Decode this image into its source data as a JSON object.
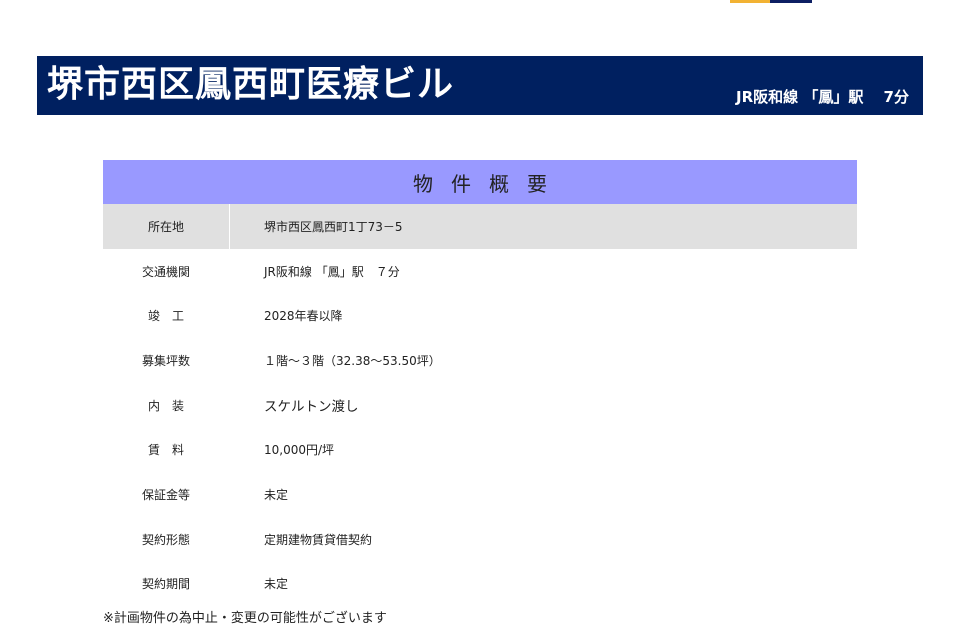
{
  "header": {
    "title": "堺市西区鳳西町医療ビル",
    "access": "JR阪和線 「鳳」駅　 7分"
  },
  "summary": {
    "heading": "物件概要",
    "rows": [
      {
        "label": "所在地",
        "value": "堺市西区鳳西町1丁73－5"
      },
      {
        "label": "交通機関",
        "value": "JR阪和線 「鳳」駅　７分"
      },
      {
        "label": "竣　工",
        "value": "2028年春以降"
      },
      {
        "label": "募集坪数",
        "value": "１階～３階（32.38～53.50坪）"
      },
      {
        "label": "内　装",
        "value": "スケルトン渡し"
      },
      {
        "label": "賃　料",
        "value": "10,000円/坪"
      },
      {
        "label": "保証金等",
        "value": "未定"
      },
      {
        "label": "契約形態",
        "value": "定期建物賃貸借契約"
      },
      {
        "label": "契約期間",
        "value": "未定"
      }
    ]
  },
  "note": "※計画物件の為中止・変更の可能性がございます",
  "colors": {
    "header_bg": "#002060",
    "summary_head_bg": "#9999ff",
    "first_row_bg": "#e0e0e0"
  }
}
